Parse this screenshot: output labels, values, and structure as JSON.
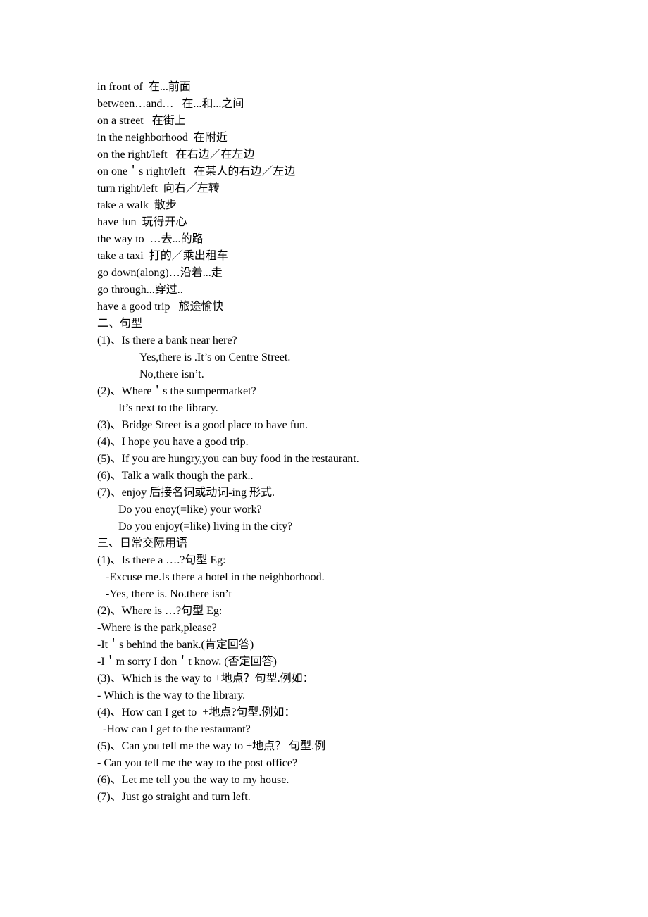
{
  "document": {
    "sections": [
      {
        "name": "vocabulary-phrases",
        "lines": [
          {
            "text": "in front of  在...前面",
            "indent": "i0"
          },
          {
            "text": "between…and…   在...和...之间",
            "indent": "i0"
          },
          {
            "text": "on a street   在街上",
            "indent": "i0"
          },
          {
            "text": "in the neighborhood  在附近",
            "indent": "i0"
          },
          {
            "text": "on the right/left   在右边／在左边",
            "indent": "i0"
          },
          {
            "text": "on one＇s right/left   在某人的右边／左边",
            "indent": "i0"
          },
          {
            "text": "turn right/left  向右／左转",
            "indent": "i0"
          },
          {
            "text": "take a walk  散步",
            "indent": "i0"
          },
          {
            "text": "have fun  玩得开心",
            "indent": "i0"
          },
          {
            "text": "the way to  …去...的路",
            "indent": "i0"
          },
          {
            "text": "take a taxi  打的／乘出租车",
            "indent": "i0"
          },
          {
            "text": "go down(along)…沿着...走",
            "indent": "i0"
          },
          {
            "text": "go through...穿过..",
            "indent": "i0"
          },
          {
            "text": "have a good trip   旅途愉快",
            "indent": "i0"
          }
        ]
      },
      {
        "name": "sentence-patterns",
        "heading": "二、句型",
        "lines": [
          {
            "text": "(1)、Is there a bank near here?",
            "indent": "i0"
          },
          {
            "text": "Yes,there is .It’s on Centre Street.",
            "indent": "i5"
          },
          {
            "text": "No,there isn’t.",
            "indent": "i5"
          },
          {
            "text": "(2)、Where＇s the sumpermarket?",
            "indent": "i0"
          },
          {
            "text": "It’s next to the library.",
            "indent": "i3"
          },
          {
            "text": "(3)、Bridge Street is a good place to have fun.",
            "indent": "i0"
          },
          {
            "text": "(4)、I hope you have a good trip.",
            "indent": "i0"
          },
          {
            "text": "(5)、If you are hungry,you can buy food in the restaurant.",
            "indent": "i0"
          },
          {
            "text": "(6)、Talk a walk though the park..",
            "indent": "i0"
          },
          {
            "text": "(7)、enjoy 后接名词或动词-ing 形式.",
            "indent": "i0"
          },
          {
            "text": "Do you enoy(=like) your work?",
            "indent": "i3"
          },
          {
            "text": "Do you enjoy(=like) living in the city?",
            "indent": "i3"
          }
        ]
      },
      {
        "name": "daily-expressions",
        "heading": "三、日常交际用语",
        "lines": [
          {
            "text": "(1)、Is there a ….?句型 Eg:",
            "indent": "i0"
          },
          {
            "text": "-Excuse me.Is there a hotel in the neighborhood.",
            "indent": "i2"
          },
          {
            "text": "-Yes, there is. No.there isn’t",
            "indent": "i2"
          },
          {
            "text": "(2)、Where is …?句型 Eg:",
            "indent": "i0"
          },
          {
            "text": "-Where is the park,please?",
            "indent": "i0"
          },
          {
            "text": "-It＇s behind the bank.(肯定回答)",
            "indent": "i0"
          },
          {
            "text": "-I＇m sorry I don＇t know. (否定回答)",
            "indent": "i0"
          },
          {
            "text": "(3)、Which is the way to +地点？句型.例如：",
            "indent": "i0"
          },
          {
            "text": "- Which is the way to the library.",
            "indent": "i0"
          },
          {
            "text": "(4)、How can I get to  +地点?句型.例如：",
            "indent": "i0"
          },
          {
            "text": "-How can I get to the restaurant?",
            "indent": "i1"
          },
          {
            "text": "(5)、Can you tell me the way to +地点？ 句型.例",
            "indent": "i0"
          },
          {
            "text": "- Can you tell me the way to the post office?",
            "indent": "i0"
          },
          {
            "text": "(6)、Let me tell you the way to my house.",
            "indent": "i0"
          },
          {
            "text": "(7)、Just go straight and turn left.",
            "indent": "i0"
          }
        ]
      }
    ]
  }
}
